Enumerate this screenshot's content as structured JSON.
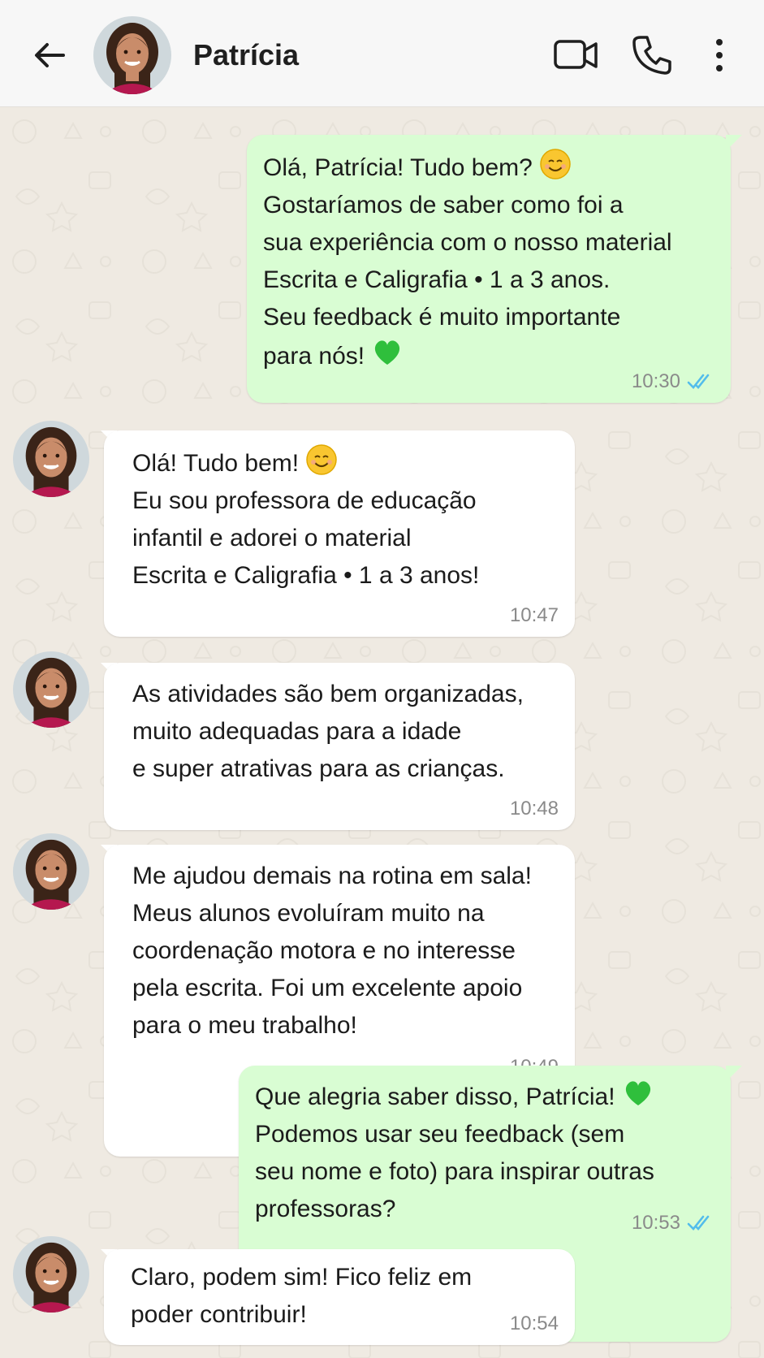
{
  "header": {
    "contact_name": "Patrícia",
    "back_icon": "arrow-left-icon",
    "video_icon": "video-camera-icon",
    "call_icon": "phone-icon",
    "menu_icon": "more-vertical-icon"
  },
  "colors": {
    "outgoing_bubble": "#d9fdd3",
    "incoming_bubble": "#ffffff",
    "chat_background": "#efeae2",
    "read_ticks": "#53bdeb"
  },
  "messages": [
    {
      "direction": "out",
      "lines": [
        "Olá, Patrícia! Tudo bem?",
        "Gostaríamos de saber como foi a",
        "sua experiência com o nosso material",
        "Escrita e Caligrafia • 1 a 3 anos.",
        "Seu feedback é muito importante",
        "para nós!"
      ],
      "time": "10:30",
      "status": "read"
    },
    {
      "direction": "in",
      "lines": [
        "Olá! Tudo bem!",
        "Eu sou professora de educação",
        "infantil e adorei o material",
        "Escrita e Caligrafia • 1 a 3 anos!"
      ],
      "time": "10:47"
    },
    {
      "direction": "in",
      "lines": [
        "As atividades são bem organizadas,",
        "muito adequadas para a idade",
        "e super atrativas para as crianças."
      ],
      "time": "10:48"
    },
    {
      "direction": "in",
      "lines": [
        "Me ajudou demais na rotina em sala!",
        "Meus alunos evoluíram muito na",
        "coordenação motora e no interesse",
        "pela escrita. Foi um excelente apoio",
        "para o meu trabalho!"
      ],
      "time": "10:49"
    },
    {
      "direction": "out",
      "lines": [
        "Que alegria saber disso, Patrícia!",
        "Podemos usar seu feedback (sem",
        "seu nome e foto) para inspirar outras",
        "professoras?"
      ],
      "time": "10:53",
      "status": "read"
    },
    {
      "direction": "in",
      "lines": [
        "Claro, podem sim! Fico feliz em",
        "poder contribuir!"
      ],
      "time": "10:54"
    }
  ]
}
